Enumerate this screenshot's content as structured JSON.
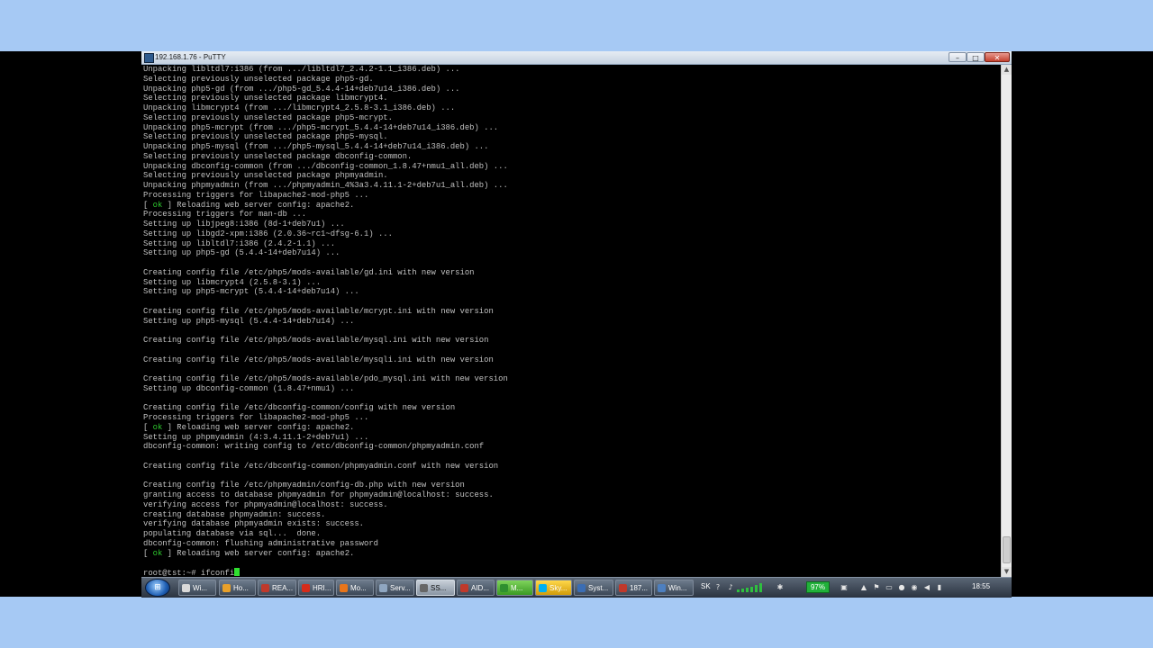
{
  "window": {
    "title": "192.168.1.76 - PuTTY",
    "min_label": "–",
    "max_label": "□",
    "close_label": "✕"
  },
  "terminal": {
    "lines": [
      "Unpacking libltdl7:i386 (from .../libltdl7_2.4.2-1.1_i386.deb) ...",
      "Selecting previously unselected package php5-gd.",
      "Unpacking php5-gd (from .../php5-gd_5.4.4-14+deb7u14_i386.deb) ...",
      "Selecting previously unselected package libmcrypt4.",
      "Unpacking libmcrypt4 (from .../libmcrypt4_2.5.8-3.1_i386.deb) ...",
      "Selecting previously unselected package php5-mcrypt.",
      "Unpacking php5-mcrypt (from .../php5-mcrypt_5.4.4-14+deb7u14_i386.deb) ...",
      "Selecting previously unselected package php5-mysql.",
      "Unpacking php5-mysql (from .../php5-mysql_5.4.4-14+deb7u14_i386.deb) ...",
      "Selecting previously unselected package dbconfig-common.",
      "Unpacking dbconfig-common (from .../dbconfig-common_1.8.47+nmu1_all.deb) ...",
      "Selecting previously unselected package phpmyadmin.",
      "Unpacking phpmyadmin (from .../phpmyadmin_4%3a3.4.11.1-2+deb7u1_all.deb) ...",
      "Processing triggers for libapache2-mod-php5 ...",
      "[ ok ] Reloading web server config: apache2.",
      "Processing triggers for man-db ...",
      "Setting up libjpeg8:i386 (8d-1+deb7u1) ...",
      "Setting up libgd2-xpm:i386 (2.0.36~rc1~dfsg-6.1) ...",
      "Setting up libltdl7:i386 (2.4.2-1.1) ...",
      "Setting up php5-gd (5.4.4-14+deb7u14) ...",
      "",
      "Creating config file /etc/php5/mods-available/gd.ini with new version",
      "Setting up libmcrypt4 (2.5.8-3.1) ...",
      "Setting up php5-mcrypt (5.4.4-14+deb7u14) ...",
      "",
      "Creating config file /etc/php5/mods-available/mcrypt.ini with new version",
      "Setting up php5-mysql (5.4.4-14+deb7u14) ...",
      "",
      "Creating config file /etc/php5/mods-available/mysql.ini with new version",
      "",
      "Creating config file /etc/php5/mods-available/mysqli.ini with new version",
      "",
      "Creating config file /etc/php5/mods-available/pdo_mysql.ini with new version",
      "Setting up dbconfig-common (1.8.47+nmu1) ...",
      "",
      "Creating config file /etc/dbconfig-common/config with new version",
      "Processing triggers for libapache2-mod-php5 ...",
      "[ ok ] Reloading web server config: apache2.",
      "Setting up phpmyadmin (4:3.4.11.1-2+deb7u1) ...",
      "dbconfig-common: writing config to /etc/dbconfig-common/phpmyadmin.conf",
      "",
      "Creating config file /etc/dbconfig-common/phpmyadmin.conf with new version",
      "",
      "Creating config file /etc/phpmyadmin/config-db.php with new version",
      "granting access to database phpmyadmin for phpmyadmin@localhost: success.",
      "verifying access for phpmyadmin@localhost: success.",
      "creating database phpmyadmin: success.",
      "verifying database phpmyadmin exists: success.",
      "populating database via sql...  done.",
      "dbconfig-common: flushing administrative password",
      "[ ok ] Reloading web server config: apache2.",
      ""
    ],
    "prompt": "root@tst:~# ",
    "command": "ifconfi"
  },
  "taskbar": {
    "items": [
      {
        "label": "Wi...",
        "icon_color": "#d9d9d9",
        "state": "normal"
      },
      {
        "label": "Ho...",
        "icon_color": "#e8a02a",
        "state": "normal"
      },
      {
        "label": "REA...",
        "icon_color": "#c0392b",
        "state": "normal"
      },
      {
        "label": "HRI...",
        "icon_color": "#d62c1a",
        "state": "normal"
      },
      {
        "label": "Mo...",
        "icon_color": "#e8751a",
        "state": "normal"
      },
      {
        "label": "Serv...",
        "icon_color": "#8fa6c0",
        "state": "normal"
      },
      {
        "label": "SS...",
        "icon_color": "#666666",
        "state": "active"
      },
      {
        "label": "AID...",
        "icon_color": "#c0392b",
        "state": "normal"
      },
      {
        "label": "M...",
        "icon_color": "#2f8f2f",
        "state": "green"
      },
      {
        "label": "Sky...",
        "icon_color": "#00aff0",
        "state": "yellow"
      },
      {
        "label": "Syst...",
        "icon_color": "#3b6db3",
        "state": "normal"
      },
      {
        "label": "187...",
        "icon_color": "#c0392b",
        "state": "normal"
      },
      {
        "label": "Win...",
        "icon_color": "#4d7fbf",
        "state": "normal"
      }
    ],
    "language": "SK",
    "battery": "97%",
    "clock": "18:55",
    "tray_icons": [
      "help-icon",
      "mic-icon",
      "network-icon",
      "flag-icon",
      "chat-icon",
      "shield-icon",
      "volume-icon",
      "signal-icon"
    ]
  },
  "scrollbar": {
    "up_arrow": "▲",
    "down_arrow": "▼"
  }
}
